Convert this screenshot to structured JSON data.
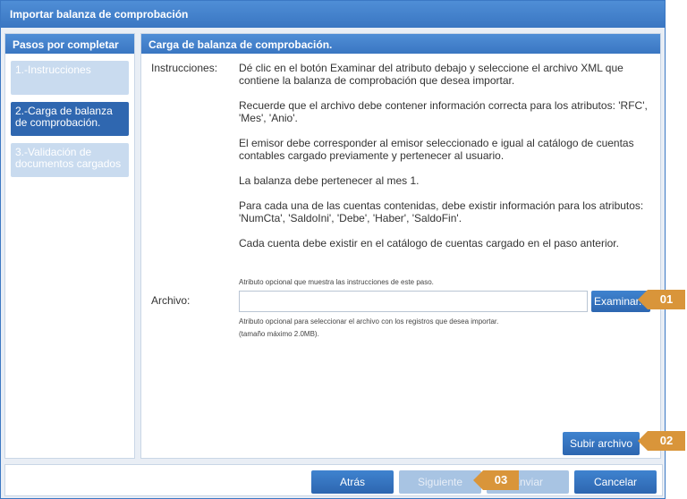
{
  "dialog": {
    "title": "Importar balanza de comprobación"
  },
  "sidebar": {
    "header": "Pasos por completar",
    "steps": [
      {
        "label": "1.-Instrucciones",
        "state": "inactive"
      },
      {
        "label": "2.-Carga de balanza de comprobación.",
        "state": "active"
      },
      {
        "label": "3.-Validación de documentos cargados",
        "state": "inactive"
      }
    ]
  },
  "main": {
    "header": "Carga de balanza de comprobación.",
    "instructions_label": "Instrucciones:",
    "instructions": [
      "Dé clic en el botón Examinar del atributo debajo y seleccione el archivo XML que contiene la balanza de comprobación que desea importar.",
      "Recuerde que el archivo debe contener información correcta para los atributos: 'RFC', 'Mes', 'Anio'.",
      "El emisor debe corresponder al emisor seleccionado e igual al catálogo de cuentas contables cargado previamente y pertenecer al usuario.",
      "La balanza debe pertenecer al mes 1.",
      "Para cada una de las cuentas contenidas, debe existir información para los atributos: 'NumCta', 'SaldoIni', 'Debe', 'Haber', 'SaldoFin'.",
      "Cada cuenta debe existir en el catálogo de cuentas cargado en el paso anterior."
    ],
    "hint_top": "Atributo opcional que muestra las instrucciones de este paso.",
    "archivo_label": "Archivo:",
    "archivo_value": "",
    "examinar_label": "Examinar...",
    "hint_file": "Atributo opcional para seleccionar el archivo con los registros que desea importar.",
    "hint_size": "(tamaño máximo 2.0MB).",
    "subir_label": "Subir archivo"
  },
  "footer": {
    "atras": "Atrás",
    "siguiente": "Siguiente",
    "enviar": "Enviar",
    "cancelar": "Cancelar"
  },
  "callouts": {
    "c1": "01",
    "c2": "02",
    "c3": "03"
  },
  "colors": {
    "accent": "#3a76c2",
    "callout": "#d9953a",
    "active_step": "#2f67b0"
  }
}
